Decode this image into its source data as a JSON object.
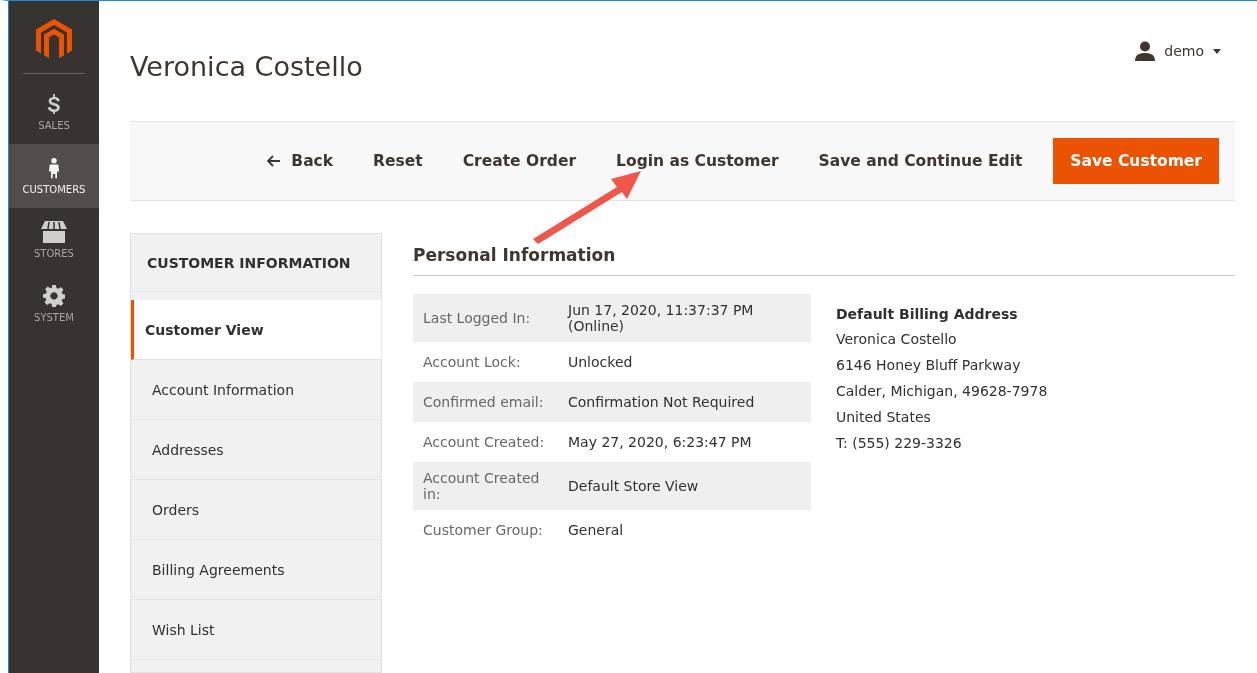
{
  "sidebar": {
    "items": [
      {
        "label": "SALES",
        "kind": "dollar",
        "selected": false
      },
      {
        "label": "CUSTOMERS",
        "kind": "person",
        "selected": true
      },
      {
        "label": "STORES",
        "kind": "store",
        "selected": false
      },
      {
        "label": "SYSTEM",
        "kind": "gear",
        "selected": false
      }
    ]
  },
  "page_title": "Veronica Costello",
  "user": {
    "name": "demo"
  },
  "toolbar": {
    "back": "Back",
    "buttons": [
      "Reset",
      "Create Order",
      "Login as Customer",
      "Save and Continue Edit"
    ],
    "primary": "Save Customer"
  },
  "tabs": {
    "title": "CUSTOMER INFORMATION",
    "items": [
      {
        "label": "Customer View",
        "selected": true
      },
      {
        "label": "Account Information",
        "selected": false
      },
      {
        "label": "Addresses",
        "selected": false
      },
      {
        "label": "Orders",
        "selected": false
      },
      {
        "label": "Billing Agreements",
        "selected": false
      },
      {
        "label": "Wish List",
        "selected": false
      }
    ]
  },
  "section_title": "Personal Information",
  "info": [
    {
      "label": "Last Logged In:",
      "value": "Jun 17, 2020, 11:37:37 PM (Online)"
    },
    {
      "label": "Account Lock:",
      "value": "Unlocked"
    },
    {
      "label": "Confirmed email:",
      "value": "Confirmation Not Required"
    },
    {
      "label": "Account Created:",
      "value": "May 27, 2020, 6:23:47 PM"
    },
    {
      "label": "Account Created in:",
      "value": "Default Store View"
    },
    {
      "label": "Customer Group:",
      "value": "General"
    }
  ],
  "billing": {
    "title": "Default Billing Address",
    "lines": [
      "Veronica Costello",
      "6146 Honey Bluff Parkway",
      "Calder, Michigan, 49628-7978",
      "United States",
      "T: (555) 229-3326"
    ]
  }
}
